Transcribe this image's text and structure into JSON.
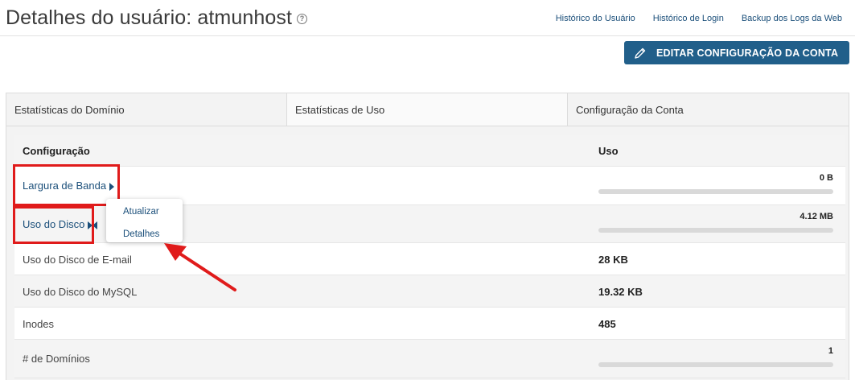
{
  "header": {
    "title": "Detalhes do usuário: atmunhost",
    "help_icon": "help-circle-icon",
    "links": [
      "Histórico do Usuário",
      "Histórico de Login",
      "Backup dos Logs da Web"
    ]
  },
  "edit_button": {
    "label": "EDITAR CONFIGURAÇÃO DA CONTA",
    "icon": "pencil-icon",
    "color": "#215f8a"
  },
  "tabs": [
    {
      "label": "Estatísticas do Domínio",
      "active": false
    },
    {
      "label": "Estatísticas de Uso",
      "active": true
    },
    {
      "label": "Configuração da Conta",
      "active": false
    }
  ],
  "table": {
    "columns": [
      "Configuração",
      "Uso"
    ],
    "rows": [
      {
        "name": "Largura de Banda",
        "value": "0 B",
        "usage_fraction": 0
      },
      {
        "name": "Uso do Disco",
        "value": "4.12 MB",
        "usage_fraction": 0
      },
      {
        "name": "Uso do Disco de E-mail",
        "value": "28 KB"
      },
      {
        "name": "Uso do Disco do MySQL",
        "value": "19.32 KB"
      },
      {
        "name": "Inodes",
        "value": "485"
      },
      {
        "name": "# de Domínios",
        "value": "1",
        "usage_fraction": 0
      }
    ]
  },
  "popup_menu": {
    "items": [
      "Atualizar",
      "Detalhes"
    ]
  },
  "annotation_color": "#e01b1b"
}
